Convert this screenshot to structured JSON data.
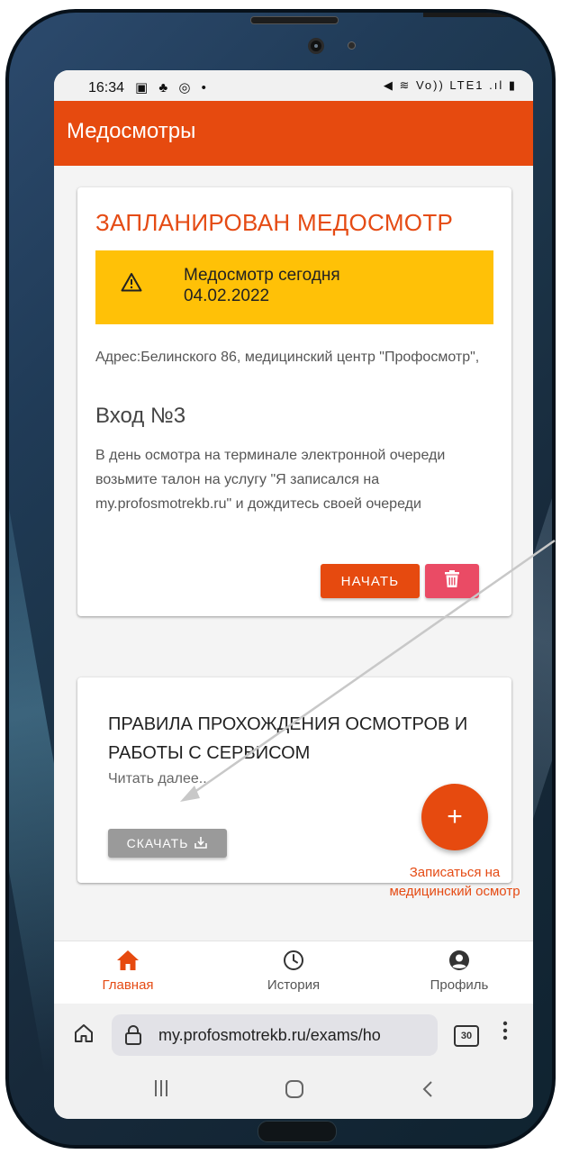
{
  "status_bar": {
    "time": "16:34",
    "left_icons": "▣ ♣ ◎ •",
    "right_icons": "◀︎ ≋ Vo)) LTE1 .ıl ▮"
  },
  "app_bar": {
    "title": "Медосмотры"
  },
  "exam_card": {
    "title": "ЗАПЛАНИРОВАН МЕДОСМОТР",
    "alert_line1": "Медосмотр сегодня",
    "alert_line2": "04.02.2022",
    "address": "Адрес:Белинского 86, медицинский центр \"Профосмотр\",",
    "entrance": "Вход №3",
    "instructions": "В день осмотра на терминале электронной очереди возьмите талон на услугу \"Я записался на my.profosmotrekb.ru\" и дождитесь своей очереди",
    "start_label": "НАЧАТЬ"
  },
  "rules_card": {
    "title": "ПРАВИЛА ПРОХОЖДЕНИЯ ОСМОТРОВ И РАБОТЫ С СЕРВИСОМ",
    "read_more": "Читать далее...",
    "download_label": "СКАЧАТЬ"
  },
  "fab": {
    "symbol": "+",
    "label": "Записаться на медицинский осмотр"
  },
  "bottom_nav": {
    "items": [
      {
        "label": "Главная",
        "icon": "home-icon",
        "active": true
      },
      {
        "label": "История",
        "icon": "clock-icon",
        "active": false
      },
      {
        "label": "Профиль",
        "icon": "account-icon",
        "active": false
      }
    ]
  },
  "browser": {
    "url": "my.profosmotrekb.ru/exams/ho",
    "tabs_count": "30",
    "menu": "⋮"
  },
  "system_nav": {
    "recents": "|||",
    "home": "◯",
    "back": "‹"
  },
  "colors": {
    "accent": "#e64a0f",
    "alert": "#ffc107",
    "delete": "#ea4b65",
    "download": "#9a9a9a"
  }
}
